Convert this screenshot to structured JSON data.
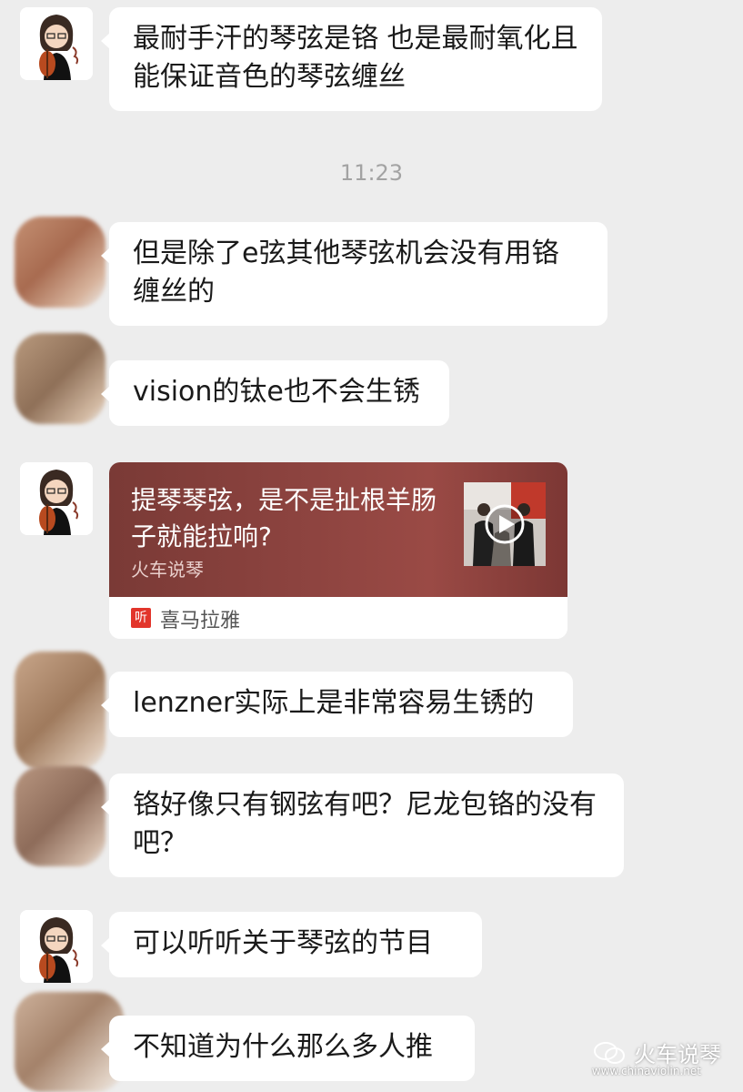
{
  "messages": [
    {
      "sender": "me",
      "avatar": "violinist-avatar",
      "text": "最耐手汗的琴弦是铬 也是最耐氧化且能保证音色的琴弦缠丝"
    },
    {
      "sender": "other",
      "avatar": "blurred-avatar",
      "text": "但是除了e弦其他琴弦机会没有用铬缠丝的"
    },
    {
      "sender": "other",
      "avatar": "blurred-avatar",
      "text": "vision的钛e也不会生锈"
    },
    {
      "sender": "other",
      "avatar": "blurred-avatar",
      "text": "lenzner实际上是非常容易生锈的"
    },
    {
      "sender": "other",
      "avatar": "blurred-avatar",
      "text": "铬好像只有钢弦有吧？尼龙包铬的没有吧？"
    },
    {
      "sender": "me",
      "avatar": "violinist-avatar",
      "text": "可以听听关于琴弦的节目"
    },
    {
      "sender": "other",
      "avatar": "blurred-avatar",
      "text": "不知道为什么那么多人推"
    }
  ],
  "timestamp": "11:23",
  "share_card": {
    "title": "提琴琴弦，是不是扯根羊肠子就能拉响?",
    "source": "火车说琴",
    "app_name": "喜马拉雅",
    "app_icon_text": "听",
    "thumbnail": "video-thumbnail-with-play-icon"
  },
  "watermark": {
    "name": "火车说琴",
    "url": "www.chinaviolin.net"
  },
  "colors": {
    "background": "#ededed",
    "bubble": "#ffffff",
    "card_accent": "#8e4440",
    "app_red": "#e2352b"
  }
}
